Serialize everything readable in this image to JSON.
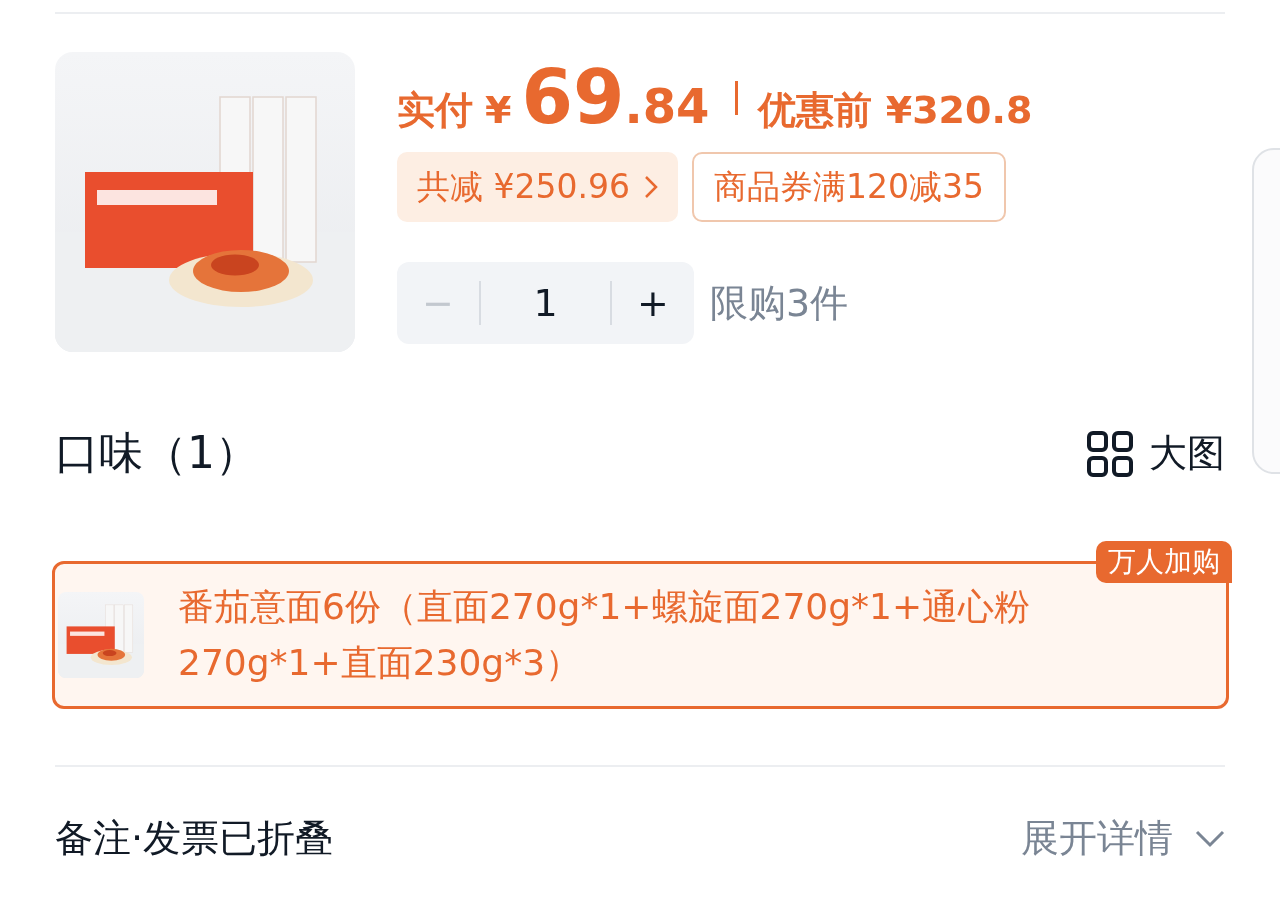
{
  "product": {
    "price": {
      "label": "实付",
      "currency": "¥",
      "integer": "69",
      "decimal": ".84",
      "original": "优惠前 ¥320.8"
    },
    "discount": {
      "total": "共减 ¥250.96"
    },
    "coupon": "商品券满120减35",
    "quantity": {
      "decrement": "−",
      "value": "1",
      "increment": "+",
      "decrement_disabled": true,
      "limit": "限购3件"
    }
  },
  "flavor": {
    "title": "口味（1）",
    "view_toggle": "大图",
    "options": [
      {
        "label": "番茄意面6份（直面270g*1+螺旋面270g*1+通心粉270g*1+直面230g*3）",
        "badge": "万人加购",
        "selected": true
      }
    ]
  },
  "remarks": {
    "label": "备注·发票已折叠",
    "action": "展开详情"
  }
}
